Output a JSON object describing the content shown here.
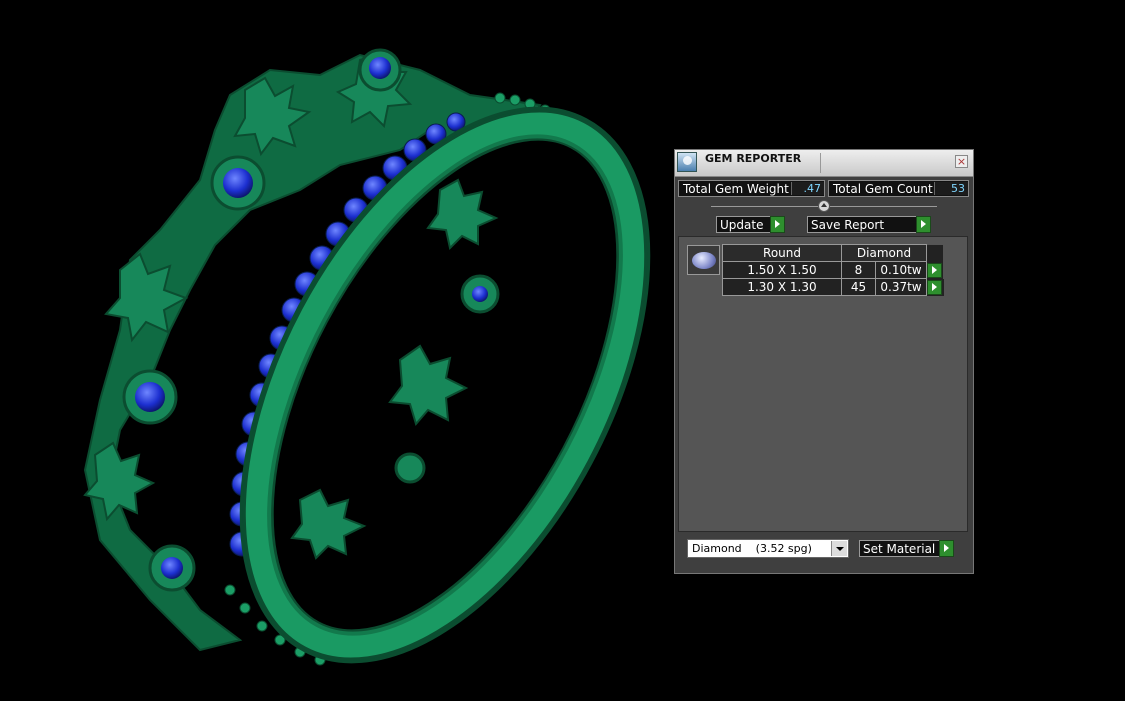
{
  "panel": {
    "title": "GEM REPORTER",
    "icons": {
      "app": "gem-reporter-icon",
      "close": "close-icon"
    }
  },
  "stats": {
    "weight_label": "Total Gem Weight",
    "weight_value": ".47",
    "count_label": "Total Gem Count",
    "count_value": "53"
  },
  "actions": {
    "update_label": "Update",
    "save_label": "Save Report"
  },
  "table": {
    "headers": [
      "Round",
      "Diamond"
    ],
    "rows": [
      {
        "size": "1.50 X 1.50",
        "count": "8",
        "weight": "0.10tw"
      },
      {
        "size": "1.30 X 1.30",
        "count": "45",
        "weight": "0.37tw"
      }
    ]
  },
  "material": {
    "selected": "Diamond    (3.52 spg)",
    "set_label": "Set Material"
  },
  "colors": {
    "metal": "#178c5a",
    "gem": "#1c2fd0",
    "accent_button": "#2e8f2e",
    "value_text": "#7fd6ff"
  }
}
